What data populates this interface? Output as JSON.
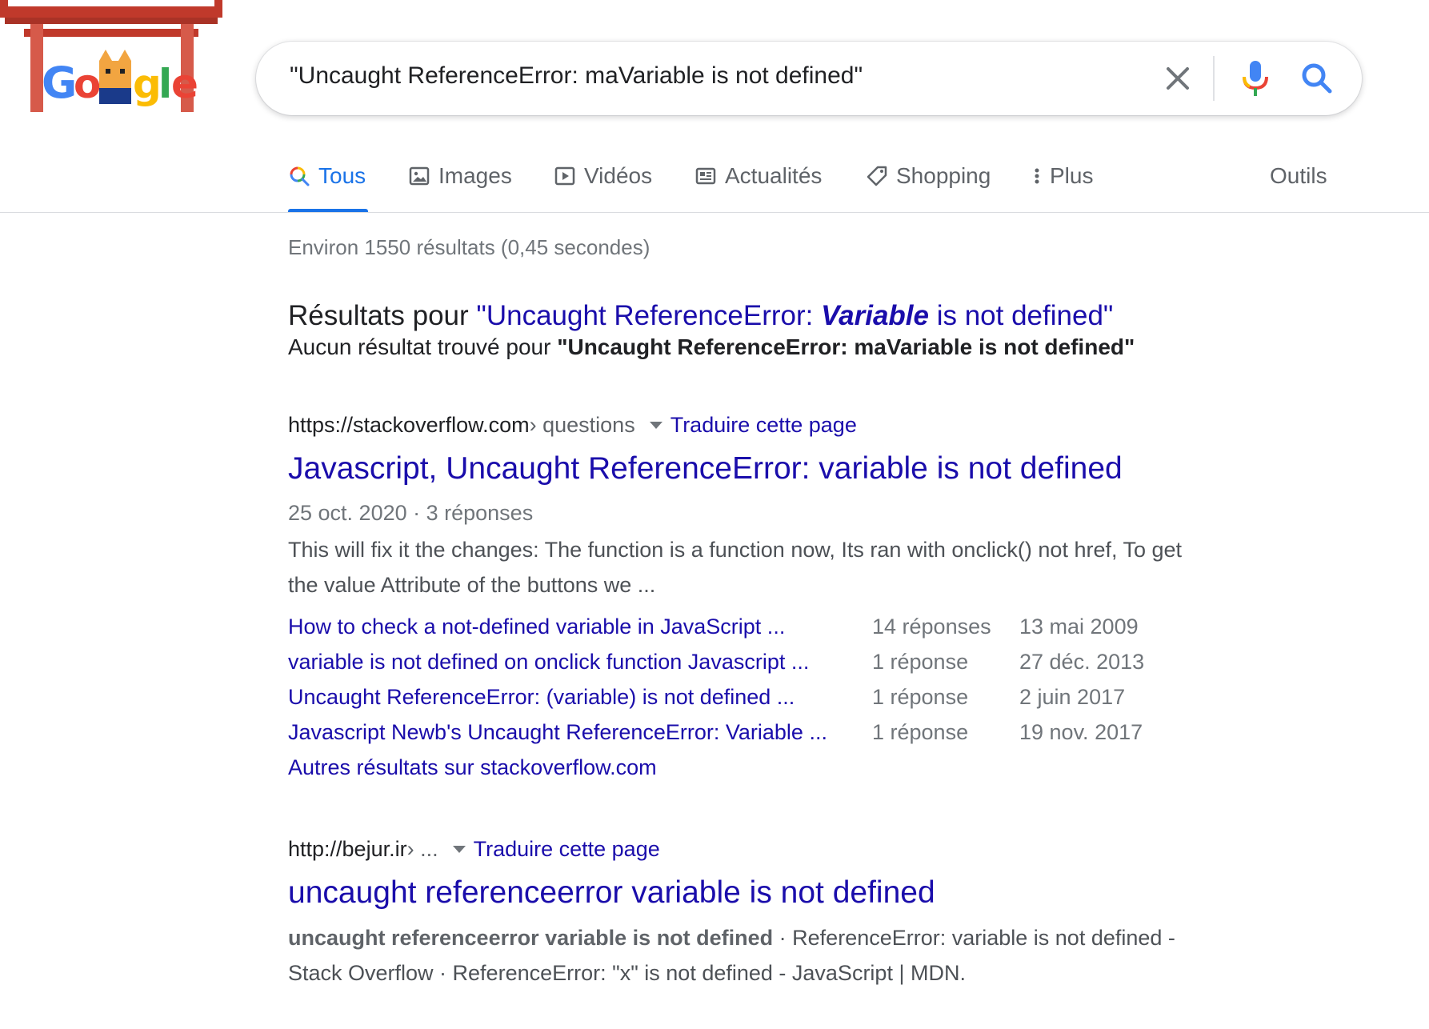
{
  "header": {
    "search_query": "\"Uncaught ReferenceError: maVariable is not defined\"",
    "doodle_icon": "google-doodle-torii-cat",
    "clear_icon": "close-icon",
    "mic_icon": "microphone-icon",
    "search_icon": "search-icon"
  },
  "tabs": [
    {
      "label": "Tous",
      "icon": "search-icon",
      "active": true
    },
    {
      "label": "Images",
      "icon": "image-icon"
    },
    {
      "label": "Vidéos",
      "icon": "play-icon"
    },
    {
      "label": "Actualités",
      "icon": "news-icon"
    },
    {
      "label": "Shopping",
      "icon": "tag-icon"
    },
    {
      "label": "Plus",
      "icon": "more-vert-icon"
    }
  ],
  "tools_label": "Outils",
  "stats": "Environ 1550 résultats (0,45 secondes)",
  "spelling": {
    "prefix": "Résultats pour ",
    "link_part1": "\"Uncaught ReferenceError: ",
    "link_emph": "Variable",
    "link_part2": " is not defined\"",
    "noresult_prefix": "Aucun résultat trouvé pour ",
    "noresult_query": "\"Uncaught ReferenceError: maVariable is not defined\""
  },
  "results": [
    {
      "url_host": "https://stackoverflow.com",
      "url_crumb": " › questions",
      "translate": "Traduire cette page",
      "title": "Javascript, Uncaught ReferenceError: variable is not defined",
      "meta": "25 oct. 2020 · 3 réponses",
      "snippet": "This will fix it the changes: The function is a function now, Its ran with onclick() not href, To get the value Attribute of the buttons we ...",
      "sublinks": [
        {
          "title": "How to check a not-defined variable in JavaScript ...",
          "answers": "14 réponses",
          "date": "13 mai 2009"
        },
        {
          "title": "variable is not defined on onclick function Javascript ...",
          "answers": "1 réponse",
          "date": "27 déc. 2013"
        },
        {
          "title": "Uncaught ReferenceError: (variable) is not defined ...",
          "answers": "1 réponse",
          "date": "2 juin 2017"
        },
        {
          "title": "Javascript Newb's Uncaught ReferenceError: Variable ...",
          "answers": "1 réponse",
          "date": "19 nov. 2017"
        }
      ],
      "more_results": "Autres résultats sur stackoverflow.com"
    },
    {
      "url_host": "http://bejur.ir",
      "url_crumb": " › ...",
      "translate": "Traduire cette page",
      "title": "uncaught referenceerror variable is not defined",
      "snippet_bold": "uncaught referenceerror variable is not defined",
      "snippet_rest": " · ReferenceError: variable is not defined - Stack Overflow · ReferenceError: \"x\" is not defined - JavaScript | MDN."
    }
  ]
}
